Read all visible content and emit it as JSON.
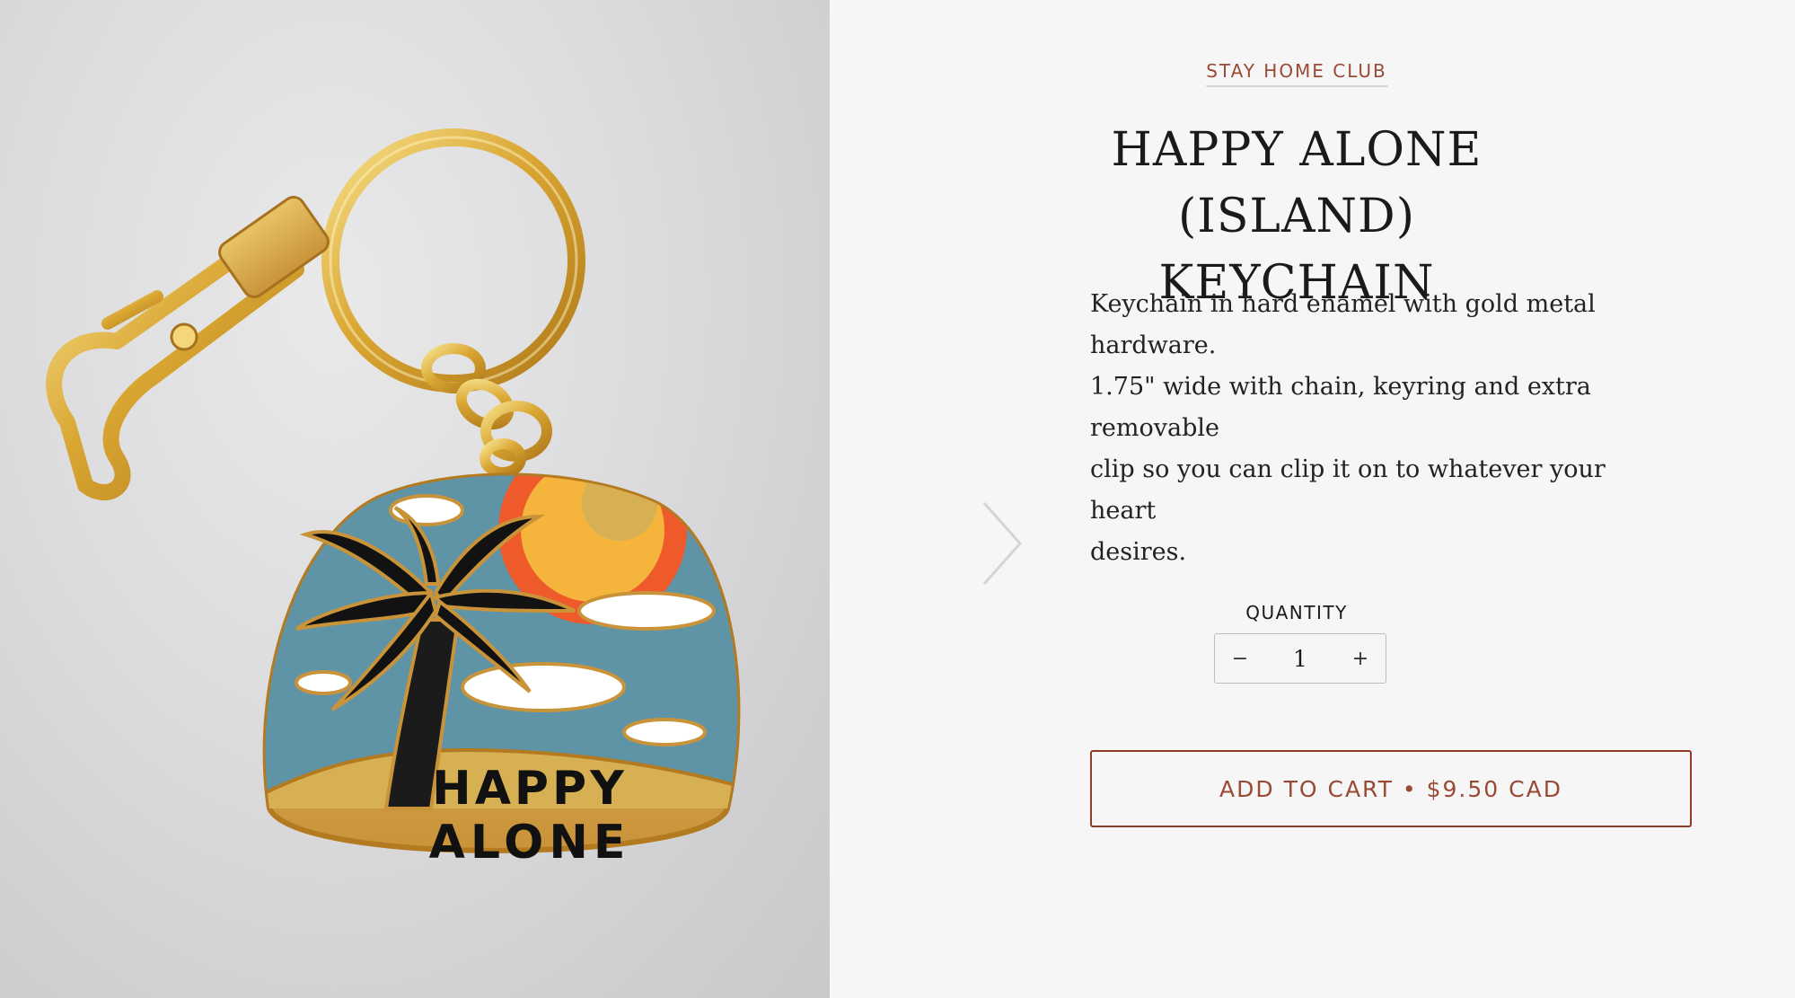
{
  "product": {
    "vendor": "STAY HOME CLUB",
    "title_line1": "HAPPY ALONE (ISLAND)",
    "title_line2": "KEYCHAIN",
    "description_lines": [
      "Keychain in hard enamel with gold metal hardware.",
      "1.75\" wide with chain, keyring and extra removable",
      "clip so you can clip it on to whatever your heart",
      "desires."
    ],
    "image": {
      "keychain_text_line1": "HAPPY",
      "keychain_text_line2": "ALONE"
    }
  },
  "quantity": {
    "label": "QUANTITY",
    "value": "1",
    "minus_label": "−",
    "plus_label": "+"
  },
  "cart": {
    "add_label": "ADD TO CART",
    "separator": "•",
    "price": "$9.50 CAD"
  },
  "icons": {
    "next": "chevron-right-icon"
  },
  "colors": {
    "accent": "#9a4a34",
    "border_accent": "#8f3b28",
    "background": "#f6f6f6"
  }
}
